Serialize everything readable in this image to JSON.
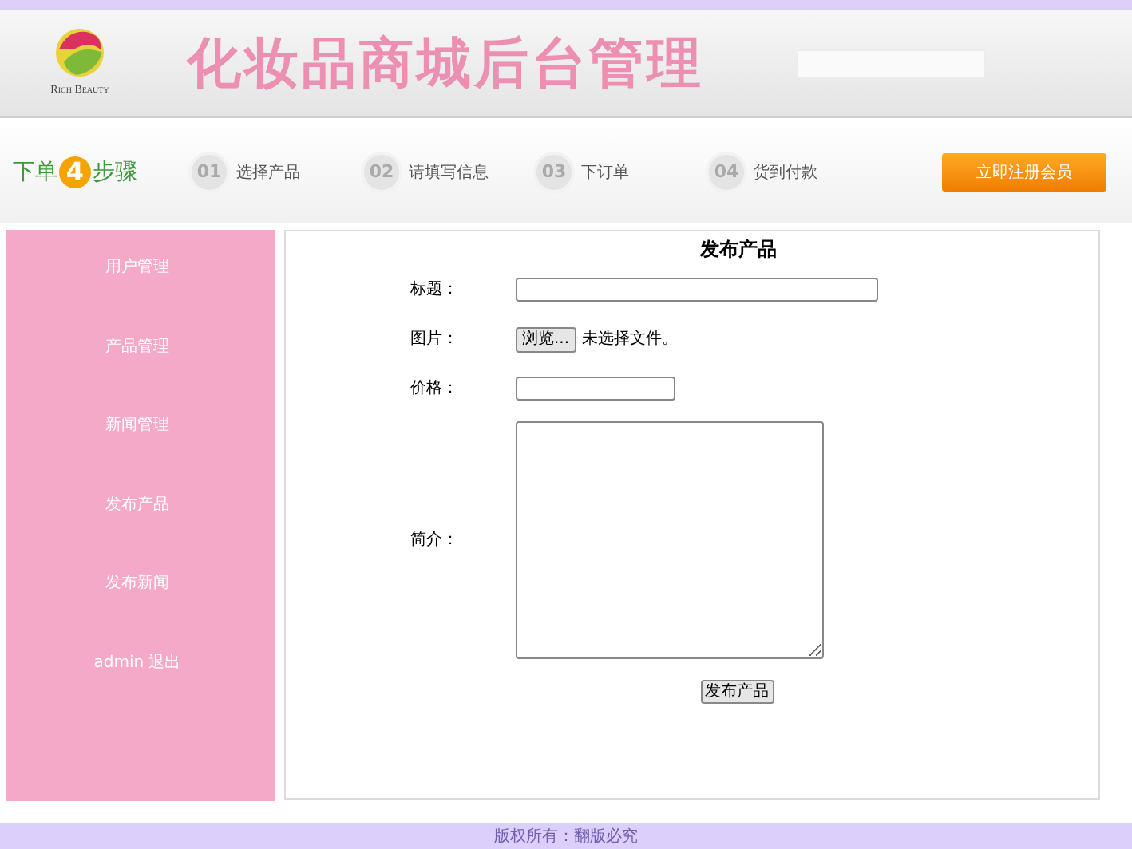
{
  "header": {
    "logo_text": "Rich Beauty",
    "title": "化妆品商城后台管理"
  },
  "steps": {
    "prefix": "下单",
    "number": "4",
    "suffix": "步骤",
    "items": [
      {
        "number": "01",
        "label": "选择产品"
      },
      {
        "number": "02",
        "label": "请填写信息"
      },
      {
        "number": "03",
        "label": "下订单"
      },
      {
        "number": "04",
        "label": "货到付款"
      }
    ],
    "register_button": "立即注册会员"
  },
  "sidebar": {
    "items": [
      {
        "label": "用户管理"
      },
      {
        "label": "产品管理"
      },
      {
        "label": "新闻管理"
      },
      {
        "label": "发布产品"
      },
      {
        "label": "发布新闻"
      },
      {
        "label": "admin 退出"
      }
    ]
  },
  "form": {
    "title": "发布产品",
    "fields": [
      {
        "kind": "text",
        "label": "标题："
      },
      {
        "kind": "file",
        "label": "图片：",
        "button": "浏览...",
        "status": "未选择文件。"
      },
      {
        "kind": "short",
        "label": "价格："
      },
      {
        "kind": "textarea",
        "label": "简介："
      }
    ],
    "submit": "发布产品"
  },
  "footer": "版权所有：翻版必究"
}
